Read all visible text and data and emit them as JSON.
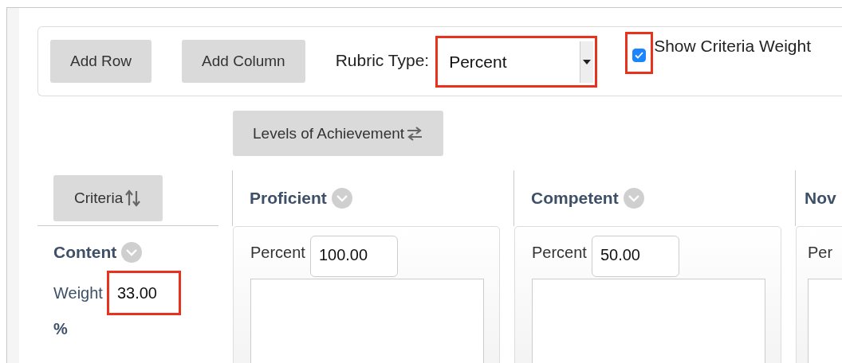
{
  "toolbar": {
    "buttons": [
      "Add Row",
      "Add Column"
    ],
    "rubric_type_label": "Rubric Type:",
    "rubric_type": {
      "value": "Percent",
      "highlighted": true
    },
    "show_weight": {
      "label": "Show Criteria Weight",
      "checked": true,
      "highlighted": true
    }
  },
  "levels_button": "Levels of Achievement",
  "criteria_button": "Criteria",
  "levels": [
    {
      "name": "Proficient"
    },
    {
      "name": "Competent"
    },
    {
      "name": "Nov"
    }
  ],
  "criteria": [
    {
      "name": "Content",
      "weight_label": "Weight",
      "weight": {
        "value": "33.00",
        "highlighted": true
      },
      "unit": "%",
      "cells": [
        {
          "label": "Percent",
          "value": "100.00"
        },
        {
          "label": "Percent",
          "value": "50.00"
        },
        {
          "label": "Per"
        }
      ]
    }
  ]
}
